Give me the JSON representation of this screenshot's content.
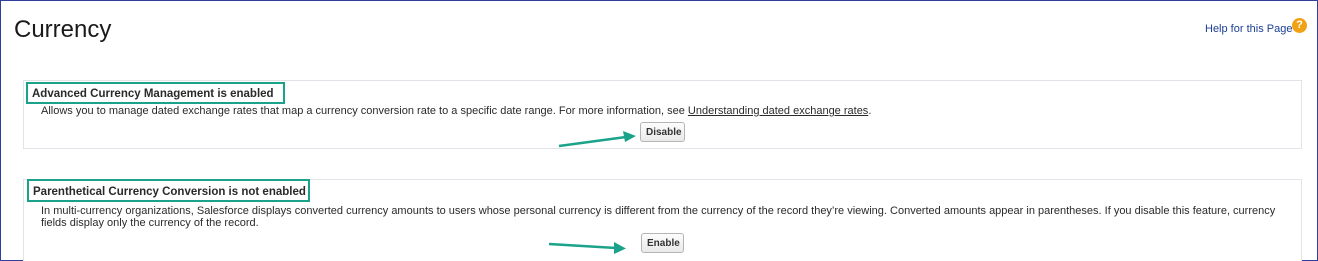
{
  "page": {
    "title": "Currency",
    "help_link": "Help for this Page",
    "help_icon": "question-mark"
  },
  "sections": [
    {
      "heading": "Advanced Currency Management is enabled",
      "description_text": "Allows you to manage dated exchange rates that map a currency conversion rate to a specific date range. For more information, see ",
      "description_link": "Understanding dated exchange rates",
      "description_tail": ".",
      "button_label": "Disable"
    },
    {
      "heading": "Parenthetical Currency Conversion is not enabled",
      "description_text": "In multi-currency organizations, Salesforce displays converted currency amounts to users whose personal currency is different from the currency of the record they’re viewing. Converted amounts appear in parentheses. If you disable this feature, currency fields display only the currency of the record.",
      "button_label": "Enable"
    }
  ],
  "colors": {
    "annotation": "#1aa38a",
    "frame": "#2f3f9e",
    "link": "#1b3f94",
    "help_icon": "#f0a214"
  }
}
